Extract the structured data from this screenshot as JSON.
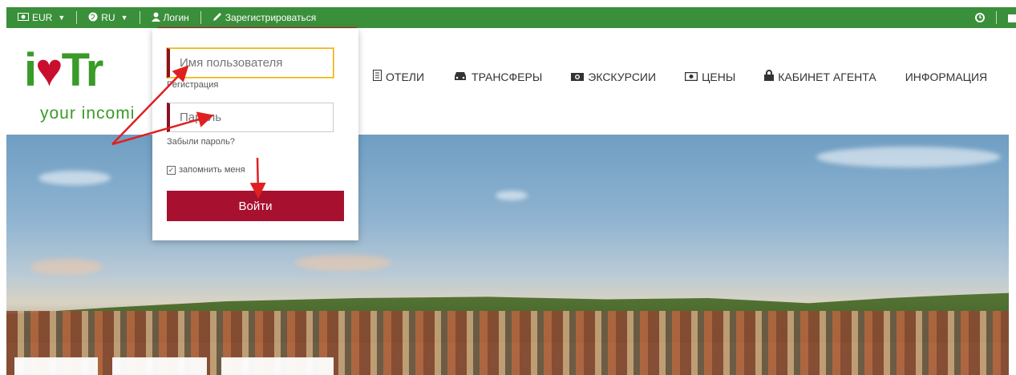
{
  "topbar": {
    "currency": "EUR",
    "language": "RU",
    "login": "Логин",
    "register": "Зарегистрироваться"
  },
  "logo": {
    "text_i": "i",
    "text_tr": "Tr",
    "tagline": "your incomi"
  },
  "nav": {
    "items": [
      {
        "label": "ОТЕЛИ",
        "icon": "building-icon"
      },
      {
        "label": "ТРАНСФЕРЫ",
        "icon": "car-icon"
      },
      {
        "label": "ЭКСКУРСИИ",
        "icon": "camera-icon"
      },
      {
        "label": "ЦЕНЫ",
        "icon": "money-icon"
      },
      {
        "label": "КАБИНЕТ АГЕНТА",
        "icon": "lock-icon"
      },
      {
        "label": "ИНФОРМАЦИЯ",
        "icon": ""
      }
    ]
  },
  "login_form": {
    "username_placeholder": "Имя пользователя",
    "registration_link": "Регистрация",
    "password_placeholder": "Пароль",
    "forgot_link": "Забыли пароль?",
    "remember_label": "запомнить меня",
    "remember_checked": true,
    "submit_label": "Войти"
  },
  "colors": {
    "topbar": "#3a8f3a",
    "accent": "#a8102f",
    "logo_green": "#3a9a2a",
    "annotation": "#e02020"
  }
}
